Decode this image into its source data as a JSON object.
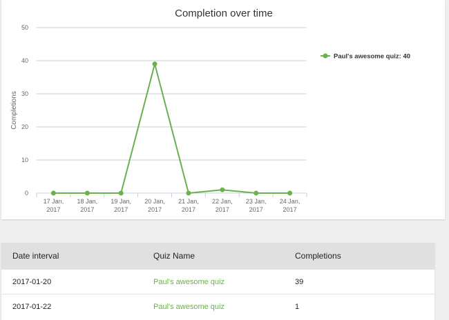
{
  "chart_data": {
    "type": "line",
    "title": "Completion over time",
    "xlabel": "",
    "ylabel": "Completions",
    "ylim": [
      0,
      50
    ],
    "yticks": [
      0,
      10,
      20,
      30,
      40,
      50
    ],
    "grid": true,
    "legend_position": "right",
    "categories": [
      [
        "17 Jan,",
        "2017"
      ],
      [
        "18 Jan,",
        "2017"
      ],
      [
        "19 Jan,",
        "2017"
      ],
      [
        "20 Jan,",
        "2017"
      ],
      [
        "21 Jan,",
        "2017"
      ],
      [
        "22 Jan,",
        "2017"
      ],
      [
        "23 Jan,",
        "2017"
      ],
      [
        "24 Jan,",
        "2017"
      ]
    ],
    "series": [
      {
        "name": "Paul's awesome quiz: 40",
        "color": "#6ab04c",
        "values": [
          0,
          0,
          0,
          39,
          0,
          1,
          0,
          0
        ]
      }
    ]
  },
  "table": {
    "headers": [
      "Date interval",
      "Quiz Name",
      "Completions"
    ],
    "rows": [
      {
        "date": "2017-01-20",
        "quiz": "Paul's awesome quiz",
        "completions": "39"
      },
      {
        "date": "2017-01-22",
        "quiz": "Paul's awesome quiz",
        "completions": "1"
      }
    ]
  },
  "colors": {
    "accent": "#6ab04c",
    "grid": "#cccccc",
    "header_bg": "#e0e0e0"
  }
}
